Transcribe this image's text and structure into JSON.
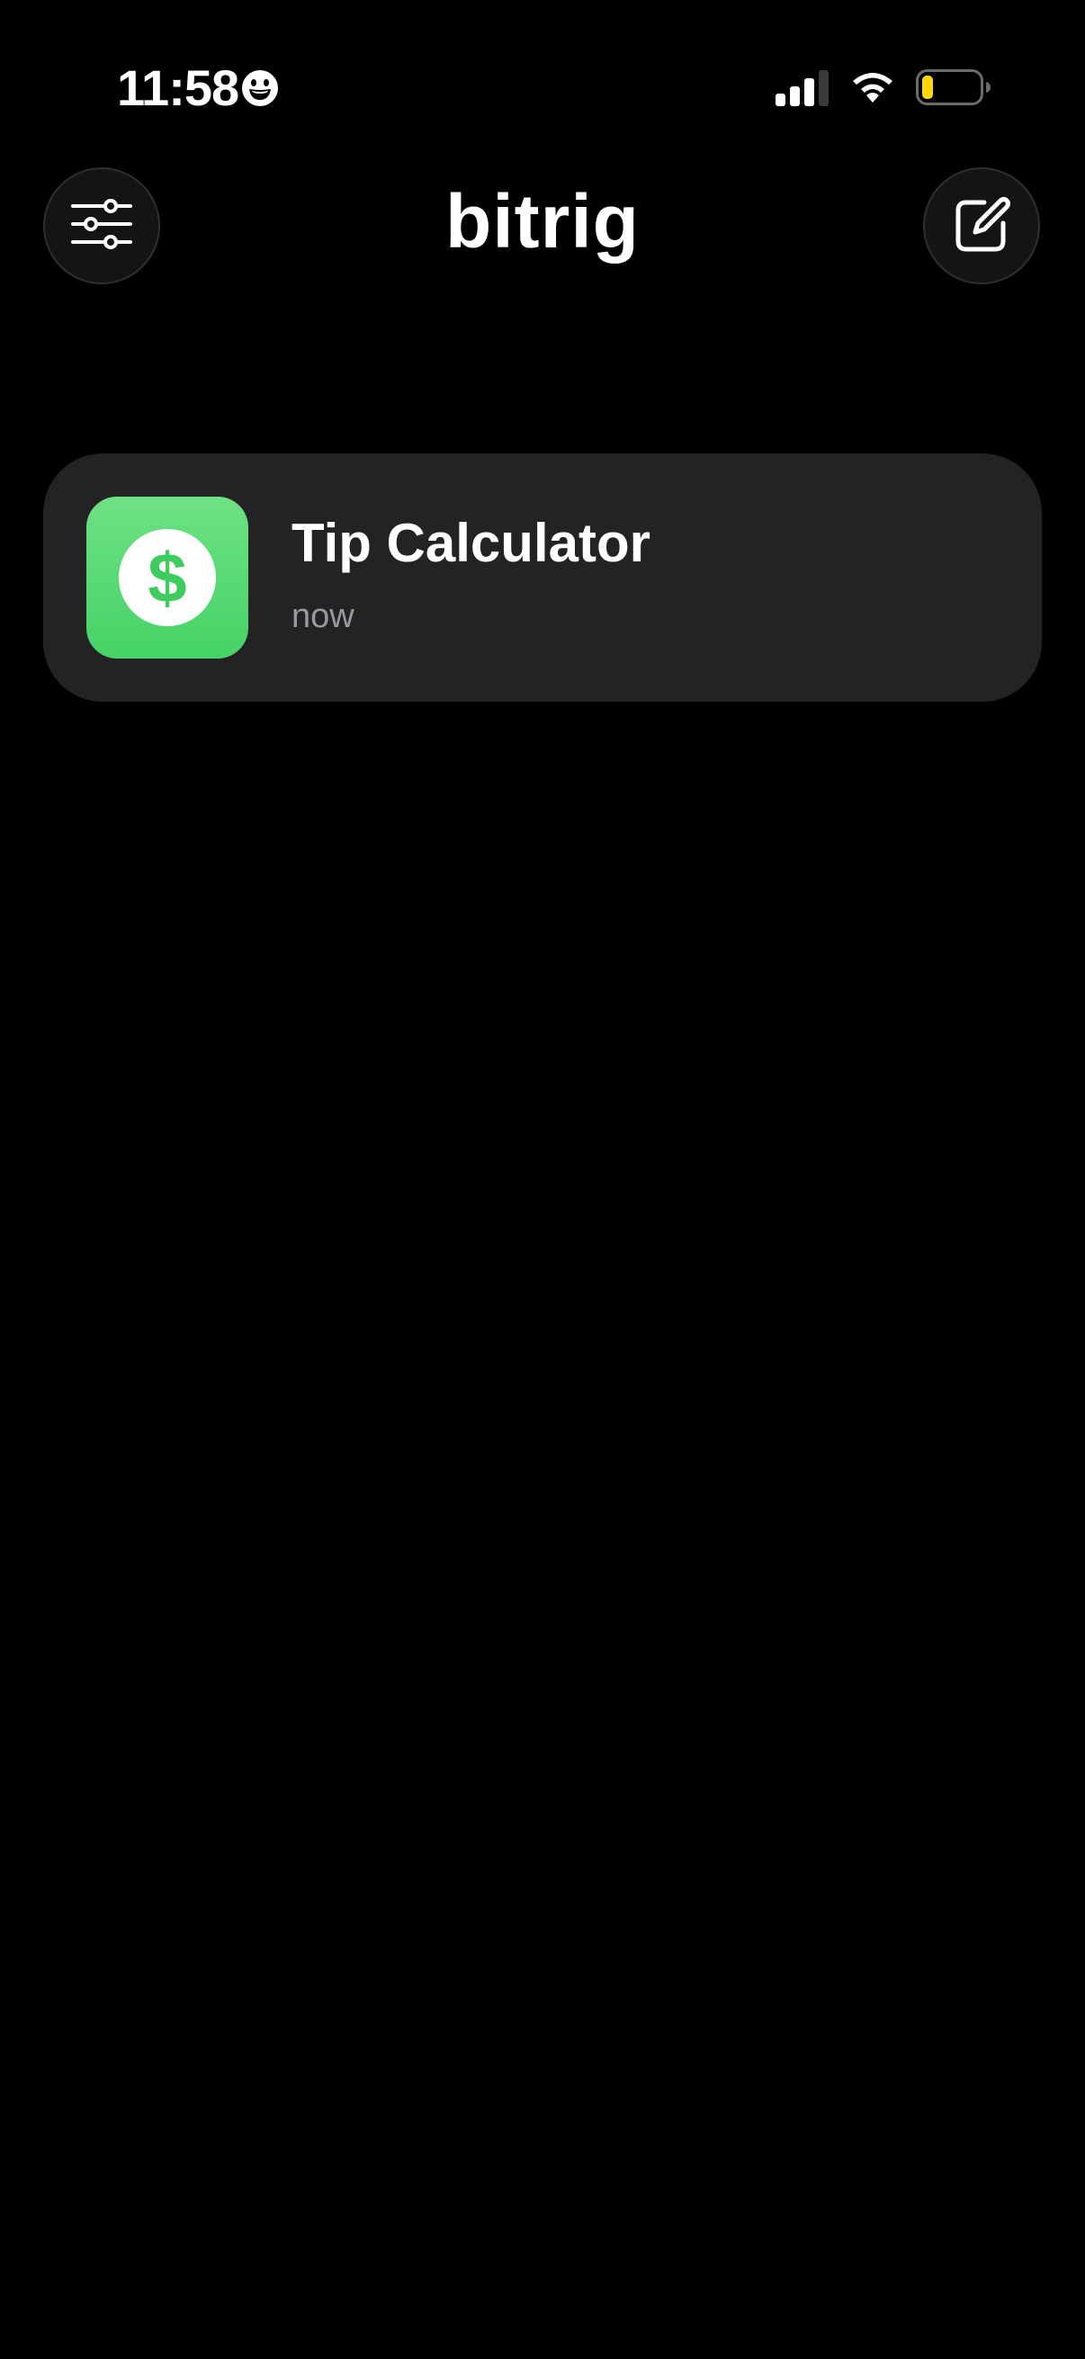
{
  "status_bar": {
    "time": "11:58",
    "emoji_icon": "smiley-face-icon",
    "signal_icon": "cellular-signal-icon",
    "wifi_icon": "wifi-icon",
    "battery_icon": "battery-low-icon",
    "battery_color": "#ffd60a"
  },
  "header": {
    "brand": "bitrig",
    "left_button_icon": "sliders-icon",
    "right_button_icon": "compose-icon"
  },
  "projects": [
    {
      "title": "Tip Calculator",
      "subtitle": "now",
      "icon_symbol": "$",
      "icon_color": "#4cd964",
      "icon": "dollar-sign-icon"
    }
  ]
}
